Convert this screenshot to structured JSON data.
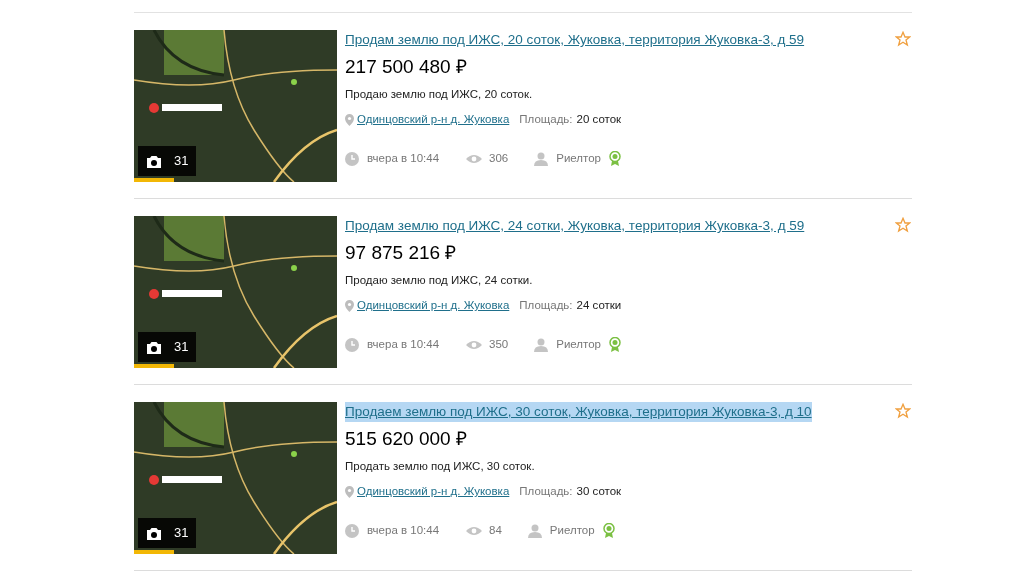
{
  "listings": [
    {
      "title": "Продам землю под ИЖС, 20 соток, Жуковка, территория Жуковка-3, д 59",
      "highlighted": false,
      "price": "217 500 480 ₽",
      "description": "Продаю землю под ИЖС, 20 соток.",
      "location": "Одинцовский р-н д. Жуковка",
      "area_label": "Площадь:",
      "area": "20 соток",
      "date": "вчера в 10:44",
      "views": "306",
      "seller": "Риелтор",
      "photo_count": "31",
      "favorite": false
    },
    {
      "title": "Продам землю под ИЖС, 24 сотки, Жуковка, территория Жуковка-3, д 59",
      "highlighted": false,
      "price": "97 875 216 ₽",
      "description": "Продаю землю под ИЖС, 24 сотки.",
      "location": "Одинцовский р-н д. Жуковка",
      "area_label": "Площадь:",
      "area": "24 сотки",
      "date": "вчера в 10:44",
      "views": "350",
      "seller": "Риелтор",
      "photo_count": "31",
      "favorite": false
    },
    {
      "title": "Продаем землю под ИЖС, 30 соток, Жуковка, территория Жуковка-3, д 10",
      "highlighted": true,
      "price": "515 620 000 ₽",
      "description": "Продать землю под ИЖС, 30 соток.",
      "location": "Одинцовский р-н д. Жуковка",
      "area_label": "Площадь:",
      "area": "30 соток",
      "date": "вчера в 10:44",
      "views": "84",
      "seller": "Риелтор",
      "photo_count": "31",
      "favorite": false
    }
  ]
}
